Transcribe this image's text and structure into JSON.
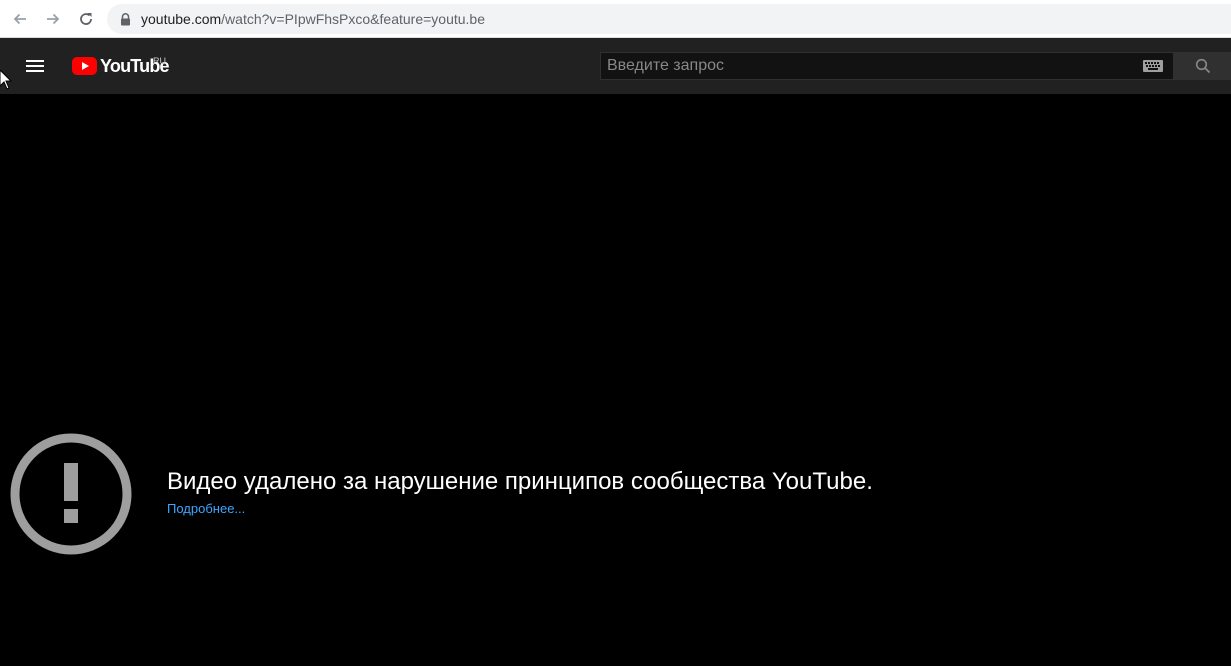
{
  "browser": {
    "url_host": "youtube.com",
    "url_path": "/watch?v=PIpwFhsPxco&feature=youtu.be",
    "icons": {
      "back": "arrow-left-icon",
      "forward": "arrow-right-icon",
      "reload": "reload-icon",
      "lock": "lock-icon"
    }
  },
  "header": {
    "logo_text": "YouTube",
    "region": "RU",
    "search": {
      "placeholder": "Введите запрос",
      "value": ""
    },
    "icons": {
      "menu": "hamburger-menu-icon",
      "keyboard": "keyboard-icon",
      "search": "search-icon"
    }
  },
  "player": {
    "error_message": "Видео удалено за нарушение принципов сообщества YouTube.",
    "learn_more": "Подробнее...",
    "icon": "exclamation-circle-icon"
  },
  "colors": {
    "header_bg": "#212121",
    "player_bg": "#000000",
    "logo_red": "#ff0000",
    "link": "#3ea6ff",
    "error_icon": "#9e9e9e"
  }
}
